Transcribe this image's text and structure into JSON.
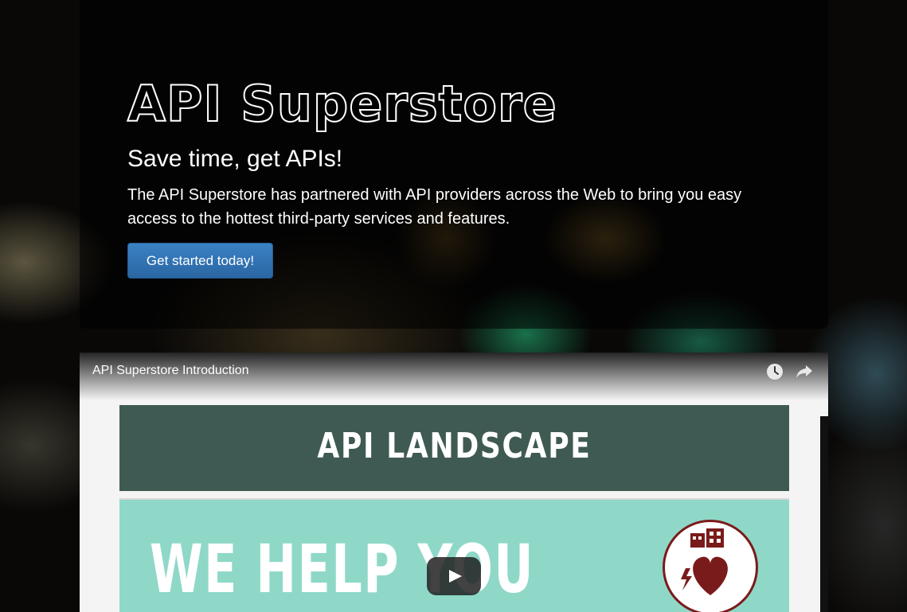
{
  "hero": {
    "brand": "API Superstore",
    "tagline": "Save time, get APIs!",
    "lead": "The API Superstore has partnered with API providers across the Web to bring you easy access to the hottest third-party services and features.",
    "cta_label": "Get started today!"
  },
  "video": {
    "title": "API Superstore Introduction",
    "icons": [
      "clock-icon",
      "share-icon",
      "play-icon"
    ],
    "slide": {
      "banner_text": "API LANDSCAPE",
      "main_text": "WE HELP YOU",
      "badge_icon": "heart-building-icon"
    }
  },
  "colors": {
    "cta": "#2f74b5",
    "slide_banner": "#3f5a52",
    "slide_teal": "#8fd8c8",
    "heart": "#7a1b1b"
  }
}
